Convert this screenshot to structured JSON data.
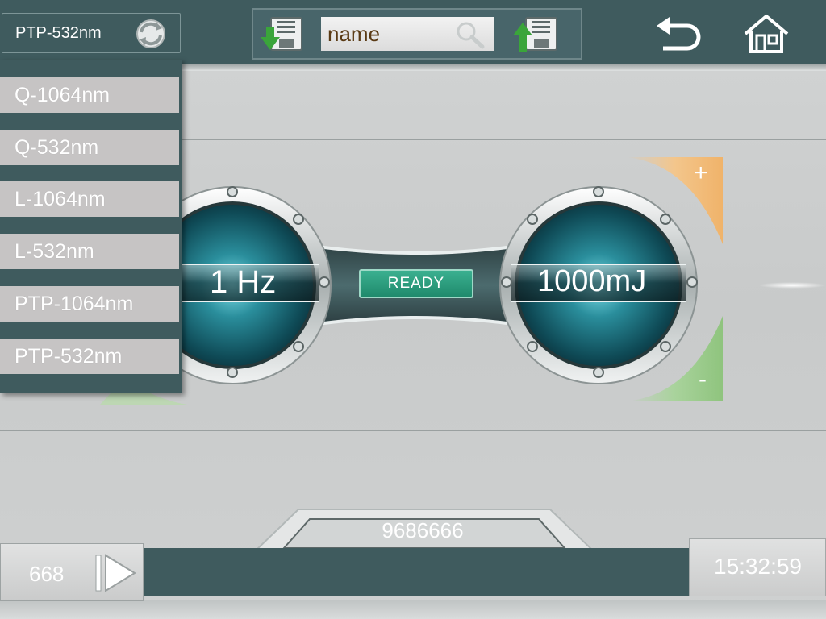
{
  "header": {
    "mode_selected": "PTP-532nm",
    "search_value": "name",
    "icons": {
      "refresh": "refresh-icon",
      "download": "download-icon",
      "search": "search-icon",
      "upload": "upload-icon",
      "back": "back-arrow-icon",
      "home": "home-icon"
    }
  },
  "mode_dropdown": {
    "items": [
      "Q-1064nm",
      "Q-532nm",
      "L-1064nm",
      "L-532nm",
      "PTP-1064nm",
      "PTP-532nm"
    ]
  },
  "display": {
    "frequency": "1 Hz",
    "energy": "1000mJ",
    "status": "READY",
    "increase_label": "+",
    "decrease_label": "-"
  },
  "footer": {
    "shot_count": "668",
    "serial_number": "9686666",
    "time": "15:32:59",
    "play_icon": "play-icon"
  },
  "colors": {
    "bar": "#3f5b5e",
    "ready": "#2aa07f",
    "plus_accent": "#f3c68c",
    "minus_accent": "#a9d39c",
    "dial": "#1e6c78"
  }
}
